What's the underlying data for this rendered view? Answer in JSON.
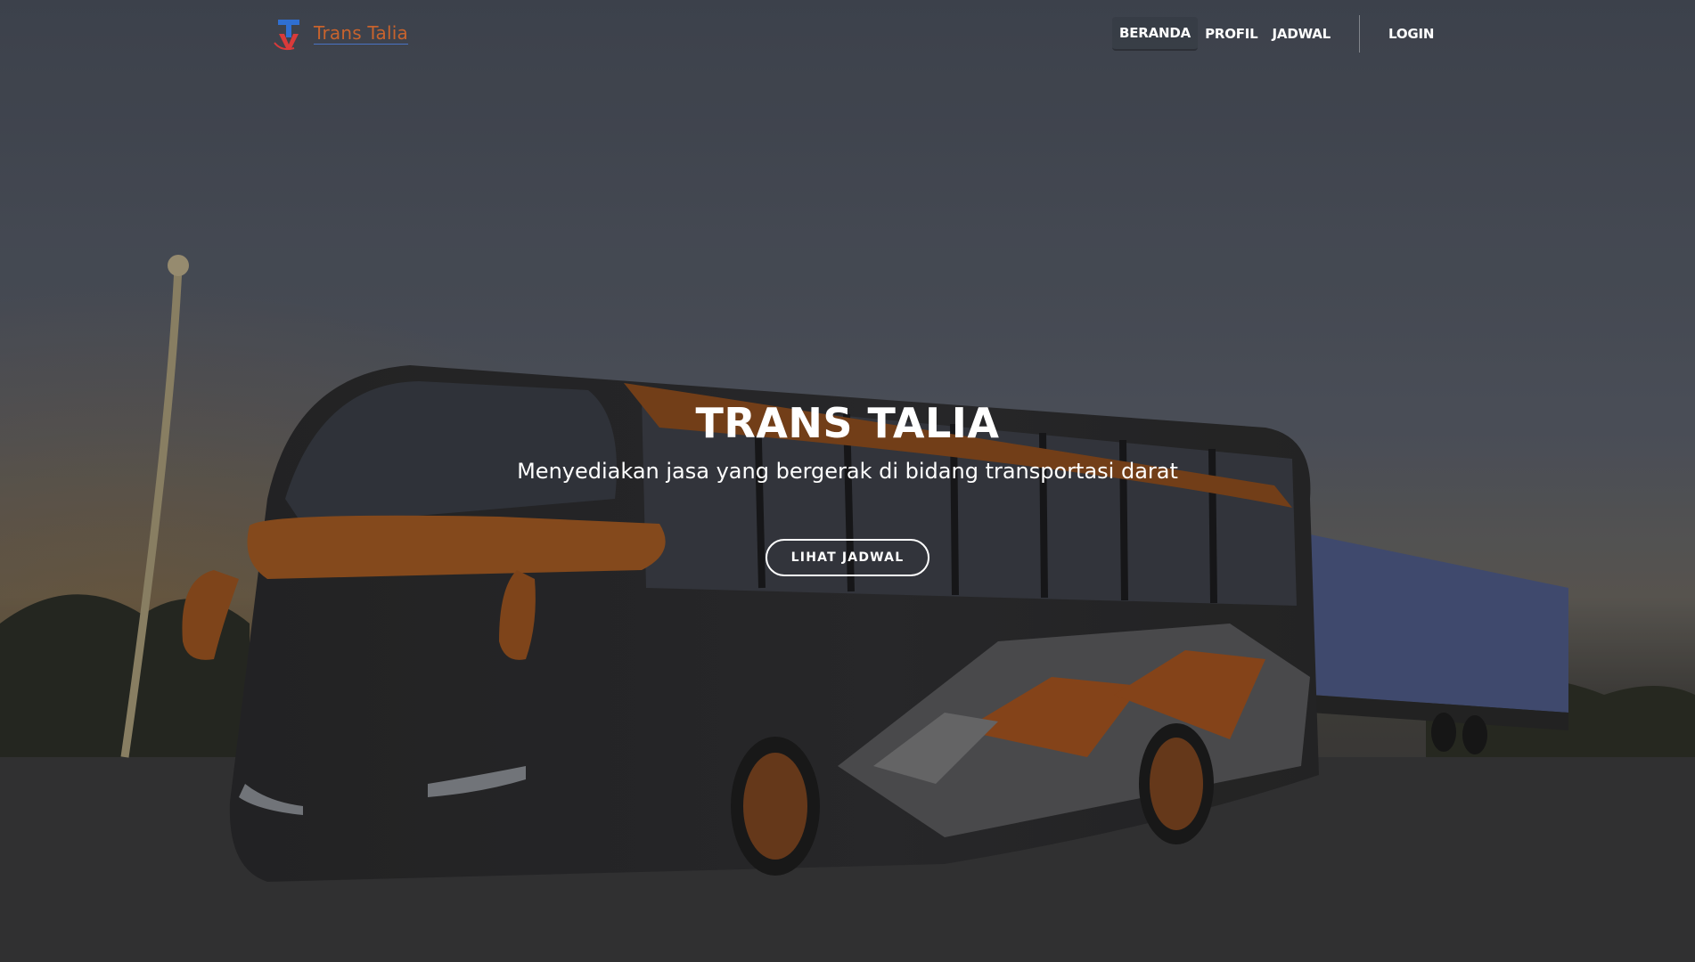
{
  "brand": {
    "name": "Trans Talia",
    "logo_icon": "tv-monogram-logo"
  },
  "nav": {
    "items": [
      {
        "label": "BERANDA",
        "active": true
      },
      {
        "label": "PROFIL",
        "active": false
      },
      {
        "label": "JADWAL",
        "active": false
      }
    ],
    "login_label": "LOGIN"
  },
  "hero": {
    "title": "TRANS TALIA",
    "subtitle": "Menyediakan jasa yang bergerak di bidang transportasi darat",
    "cta_label": "LIHAT JADWAL",
    "background_image": "bus-photo"
  },
  "colors": {
    "brand_text": "#c8632d",
    "brand_underline": "#4a73c4",
    "logo_blue": "#2f6fd1",
    "logo_red": "#d93a3a",
    "text": "#ffffff"
  }
}
